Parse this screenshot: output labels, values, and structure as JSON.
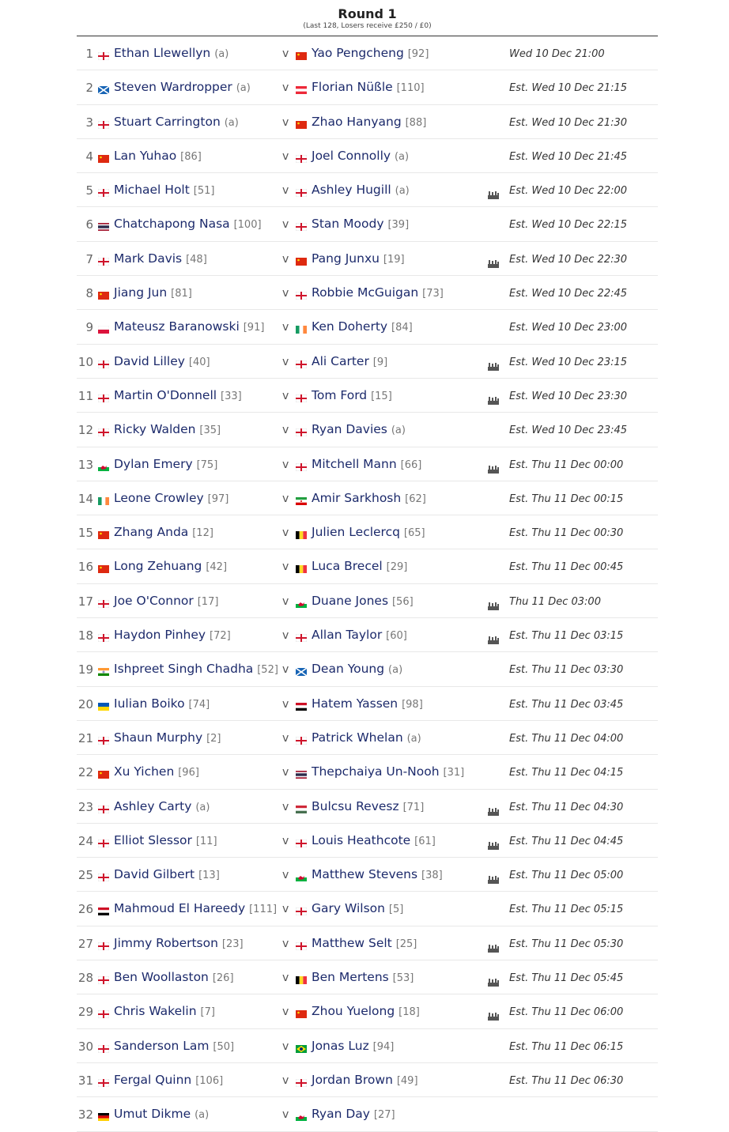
{
  "round": {
    "title": "Round 1",
    "subtitle": "(Last 128, Losers receive £250 / £0)"
  },
  "vs_label": "v",
  "matches": [
    {
      "num": "1",
      "p1": {
        "name": "Ethan Llewellyn",
        "rank": "(a)",
        "flag": "eng"
      },
      "p2": {
        "name": "Yao Pengcheng",
        "rank": "[92]",
        "flag": "chn"
      },
      "tv": false,
      "time": "Wed 10 Dec 21:00"
    },
    {
      "num": "2",
      "p1": {
        "name": "Steven Wardropper",
        "rank": "(a)",
        "flag": "sco"
      },
      "p2": {
        "name": "Florian Nüßle",
        "rank": "[110]",
        "flag": "aut"
      },
      "tv": false,
      "time": "Est. Wed 10 Dec 21:15"
    },
    {
      "num": "3",
      "p1": {
        "name": "Stuart Carrington",
        "rank": "(a)",
        "flag": "eng"
      },
      "p2": {
        "name": "Zhao Hanyang",
        "rank": "[88]",
        "flag": "chn"
      },
      "tv": false,
      "time": "Est. Wed 10 Dec 21:30"
    },
    {
      "num": "4",
      "p1": {
        "name": "Lan Yuhao",
        "rank": "[86]",
        "flag": "chn"
      },
      "p2": {
        "name": "Joel Connolly",
        "rank": "(a)",
        "flag": "eng"
      },
      "tv": false,
      "time": "Est. Wed 10 Dec 21:45"
    },
    {
      "num": "5",
      "p1": {
        "name": "Michael Holt",
        "rank": "[51]",
        "flag": "eng"
      },
      "p2": {
        "name": "Ashley Hugill",
        "rank": "(a)",
        "flag": "eng"
      },
      "tv": true,
      "time": "Est. Wed 10 Dec 22:00"
    },
    {
      "num": "6",
      "p1": {
        "name": "Chatchapong Nasa",
        "rank": "[100]",
        "flag": "tha"
      },
      "p2": {
        "name": "Stan Moody",
        "rank": "[39]",
        "flag": "eng"
      },
      "tv": false,
      "time": "Est. Wed 10 Dec 22:15"
    },
    {
      "num": "7",
      "p1": {
        "name": "Mark Davis",
        "rank": "[48]",
        "flag": "eng"
      },
      "p2": {
        "name": "Pang Junxu",
        "rank": "[19]",
        "flag": "chn"
      },
      "tv": true,
      "time": "Est. Wed 10 Dec 22:30"
    },
    {
      "num": "8",
      "p1": {
        "name": "Jiang Jun",
        "rank": "[81]",
        "flag": "chn"
      },
      "p2": {
        "name": "Robbie McGuigan",
        "rank": "[73]",
        "flag": "eng"
      },
      "tv": false,
      "time": "Est. Wed 10 Dec 22:45"
    },
    {
      "num": "9",
      "p1": {
        "name": "Mateusz Baranowski",
        "rank": "[91]",
        "flag": "pol"
      },
      "p2": {
        "name": "Ken Doherty",
        "rank": "[84]",
        "flag": "irl"
      },
      "tv": false,
      "time": "Est. Wed 10 Dec 23:00"
    },
    {
      "num": "10",
      "p1": {
        "name": "David Lilley",
        "rank": "[40]",
        "flag": "eng"
      },
      "p2": {
        "name": "Ali Carter",
        "rank": "[9]",
        "flag": "eng"
      },
      "tv": true,
      "time": "Est. Wed 10 Dec 23:15"
    },
    {
      "num": "11",
      "p1": {
        "name": "Martin O'Donnell",
        "rank": "[33]",
        "flag": "eng"
      },
      "p2": {
        "name": "Tom Ford",
        "rank": "[15]",
        "flag": "eng"
      },
      "tv": true,
      "time": "Est. Wed 10 Dec 23:30"
    },
    {
      "num": "12",
      "p1": {
        "name": "Ricky Walden",
        "rank": "[35]",
        "flag": "eng"
      },
      "p2": {
        "name": "Ryan Davies",
        "rank": "(a)",
        "flag": "eng"
      },
      "tv": false,
      "time": "Est. Wed 10 Dec 23:45"
    },
    {
      "num": "13",
      "p1": {
        "name": "Dylan Emery",
        "rank": "[75]",
        "flag": "wal"
      },
      "p2": {
        "name": "Mitchell Mann",
        "rank": "[66]",
        "flag": "eng"
      },
      "tv": true,
      "time": "Est. Thu 11 Dec 00:00"
    },
    {
      "num": "14",
      "p1": {
        "name": "Leone Crowley",
        "rank": "[97]",
        "flag": "irl"
      },
      "p2": {
        "name": "Amir Sarkhosh",
        "rank": "[62]",
        "flag": "irn"
      },
      "tv": false,
      "time": "Est. Thu 11 Dec 00:15"
    },
    {
      "num": "15",
      "p1": {
        "name": "Zhang Anda",
        "rank": "[12]",
        "flag": "chn"
      },
      "p2": {
        "name": "Julien Leclercq",
        "rank": "[65]",
        "flag": "bel"
      },
      "tv": false,
      "time": "Est. Thu 11 Dec 00:30"
    },
    {
      "num": "16",
      "p1": {
        "name": "Long Zehuang",
        "rank": "[42]",
        "flag": "chn"
      },
      "p2": {
        "name": "Luca Brecel",
        "rank": "[29]",
        "flag": "bel"
      },
      "tv": false,
      "time": "Est. Thu 11 Dec 00:45"
    },
    {
      "num": "17",
      "p1": {
        "name": "Joe O'Connor",
        "rank": "[17]",
        "flag": "eng"
      },
      "p2": {
        "name": "Duane Jones",
        "rank": "[56]",
        "flag": "wal"
      },
      "tv": true,
      "time": "Thu 11 Dec 03:00"
    },
    {
      "num": "18",
      "p1": {
        "name": "Haydon Pinhey",
        "rank": "[72]",
        "flag": "eng"
      },
      "p2": {
        "name": "Allan Taylor",
        "rank": "[60]",
        "flag": "eng"
      },
      "tv": true,
      "time": "Est. Thu 11 Dec 03:15"
    },
    {
      "num": "19",
      "p1": {
        "name": "Ishpreet Singh Chadha",
        "rank": "[52]",
        "flag": "ind"
      },
      "p2": {
        "name": "Dean Young",
        "rank": "(a)",
        "flag": "sco"
      },
      "tv": false,
      "time": "Est. Thu 11 Dec 03:30"
    },
    {
      "num": "20",
      "p1": {
        "name": "Iulian Boiko",
        "rank": "[74]",
        "flag": "ukr"
      },
      "p2": {
        "name": "Hatem Yassen",
        "rank": "[98]",
        "flag": "egy"
      },
      "tv": false,
      "time": "Est. Thu 11 Dec 03:45"
    },
    {
      "num": "21",
      "p1": {
        "name": "Shaun Murphy",
        "rank": "[2]",
        "flag": "eng"
      },
      "p2": {
        "name": "Patrick Whelan",
        "rank": "(a)",
        "flag": "eng"
      },
      "tv": false,
      "time": "Est. Thu 11 Dec 04:00"
    },
    {
      "num": "22",
      "p1": {
        "name": "Xu Yichen",
        "rank": "[96]",
        "flag": "chn"
      },
      "p2": {
        "name": "Thepchaiya Un-Nooh",
        "rank": "[31]",
        "flag": "tha"
      },
      "tv": false,
      "time": "Est. Thu 11 Dec 04:15"
    },
    {
      "num": "23",
      "p1": {
        "name": "Ashley Carty",
        "rank": "(a)",
        "flag": "eng"
      },
      "p2": {
        "name": "Bulcsu Revesz",
        "rank": "[71]",
        "flag": "hun"
      },
      "tv": true,
      "time": "Est. Thu 11 Dec 04:30"
    },
    {
      "num": "24",
      "p1": {
        "name": "Elliot Slessor",
        "rank": "[11]",
        "flag": "eng"
      },
      "p2": {
        "name": "Louis Heathcote",
        "rank": "[61]",
        "flag": "eng"
      },
      "tv": true,
      "time": "Est. Thu 11 Dec 04:45"
    },
    {
      "num": "25",
      "p1": {
        "name": "David Gilbert",
        "rank": "[13]",
        "flag": "eng"
      },
      "p2": {
        "name": "Matthew Stevens",
        "rank": "[38]",
        "flag": "wal"
      },
      "tv": true,
      "time": "Est. Thu 11 Dec 05:00"
    },
    {
      "num": "26",
      "p1": {
        "name": "Mahmoud El Hareedy",
        "rank": "[111]",
        "flag": "egy"
      },
      "p2": {
        "name": "Gary Wilson",
        "rank": "[5]",
        "flag": "eng"
      },
      "tv": false,
      "time": "Est. Thu 11 Dec 05:15"
    },
    {
      "num": "27",
      "p1": {
        "name": "Jimmy Robertson",
        "rank": "[23]",
        "flag": "eng"
      },
      "p2": {
        "name": "Matthew Selt",
        "rank": "[25]",
        "flag": "eng"
      },
      "tv": true,
      "time": "Est. Thu 11 Dec 05:30"
    },
    {
      "num": "28",
      "p1": {
        "name": "Ben Woollaston",
        "rank": "[26]",
        "flag": "eng"
      },
      "p2": {
        "name": "Ben Mertens",
        "rank": "[53]",
        "flag": "bel"
      },
      "tv": true,
      "time": "Est. Thu 11 Dec 05:45"
    },
    {
      "num": "29",
      "p1": {
        "name": "Chris Wakelin",
        "rank": "[7]",
        "flag": "eng"
      },
      "p2": {
        "name": "Zhou Yuelong",
        "rank": "[18]",
        "flag": "chn"
      },
      "tv": true,
      "time": "Est. Thu 11 Dec 06:00"
    },
    {
      "num": "30",
      "p1": {
        "name": "Sanderson Lam",
        "rank": "[50]",
        "flag": "eng"
      },
      "p2": {
        "name": "Jonas Luz",
        "rank": "[94]",
        "flag": "bra"
      },
      "tv": false,
      "time": "Est. Thu 11 Dec 06:15"
    },
    {
      "num": "31",
      "p1": {
        "name": "Fergal Quinn",
        "rank": "[106]",
        "flag": "eng"
      },
      "p2": {
        "name": "Jordan Brown",
        "rank": "[49]",
        "flag": "eng"
      },
      "tv": false,
      "time": "Est. Thu 11 Dec 06:30"
    },
    {
      "num": "32",
      "p1": {
        "name": "Umut Dikme",
        "rank": "(a)",
        "flag": "ger"
      },
      "p2": {
        "name": "Ryan Day",
        "rank": "[27]",
        "flag": "wal"
      },
      "tv": false,
      "time": ""
    }
  ]
}
